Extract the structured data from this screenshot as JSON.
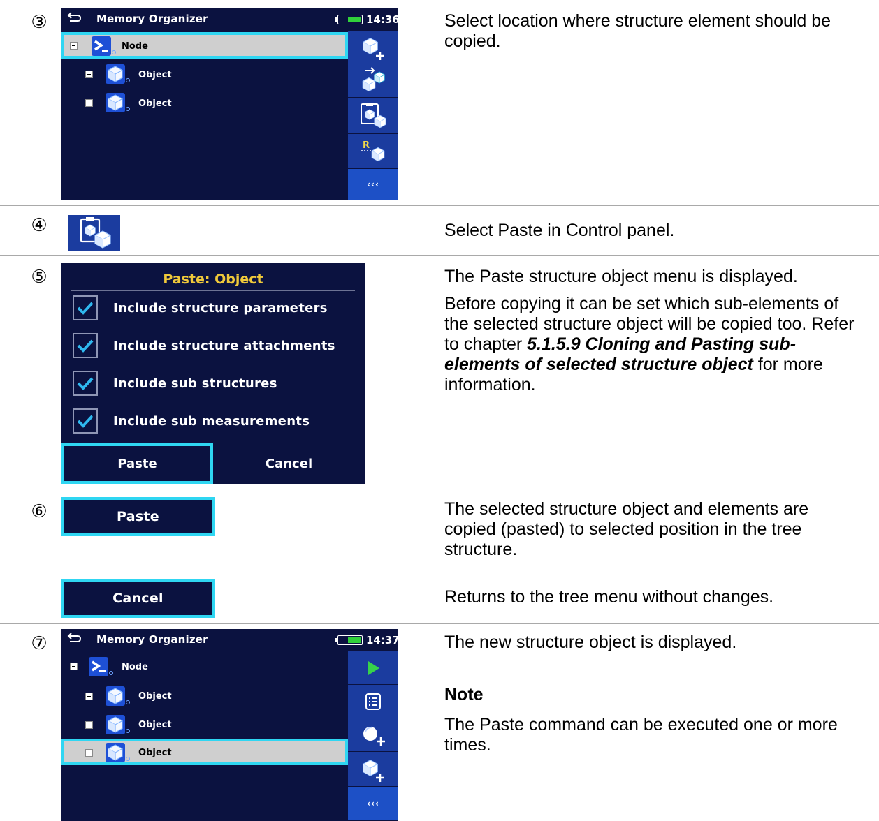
{
  "steps": [
    {
      "number": "③",
      "screen": {
        "title": "Memory Organizer",
        "time": "14:36",
        "battery_icon": "battery-icon",
        "tree": [
          {
            "label": "Node",
            "icon": "node-icon",
            "expander": "minus",
            "selected": true
          },
          {
            "label": "Object",
            "icon": "object-icon",
            "expander": "plus",
            "selected": false
          },
          {
            "label": "Object",
            "icon": "object-icon",
            "expander": "plus",
            "selected": false
          }
        ],
        "panel": [
          "add-structure-icon",
          "copy-structure-icon",
          "paste-structure-icon",
          "recall-structure-icon"
        ],
        "more_label": "‹‹‹"
      },
      "text": "Select location where structure element should be copied."
    },
    {
      "number": "④",
      "icon": "paste-structure-icon",
      "text": "Select Paste in Control panel."
    },
    {
      "number": "⑤",
      "dialog": {
        "title": "Paste: Object",
        "options": [
          {
            "label": "Include structure parameters",
            "checked": true
          },
          {
            "label": "Include structure attachments",
            "checked": true
          },
          {
            "label": "Include sub structures",
            "checked": true
          },
          {
            "label": "Include sub measurements",
            "checked": true
          }
        ],
        "paste_label": "Paste",
        "cancel_label": "Cancel"
      },
      "text_1": "The Paste structure object menu is displayed.",
      "text_2a": "Before copying it can be set which sub-elements of the selected structure object will be copied too. Refer to chapter ",
      "text_2b": "5.1.5.9 Cloning and Pasting sub-elements of selected structure object",
      "text_2c": " for more information."
    },
    {
      "number": "⑥",
      "paste_label": "Paste",
      "cancel_label": "Cancel",
      "paste_text": "The selected structure object and elements are copied (pasted) to selected position in the tree structure.",
      "cancel_text": "Returns to the tree menu without changes."
    },
    {
      "number": "⑦",
      "screen": {
        "title": "Memory Organizer",
        "time": "14:37",
        "battery_icon": "battery-icon",
        "tree": [
          {
            "label": "Node",
            "icon": "node-icon",
            "expander": "minus",
            "selected": false
          },
          {
            "label": "Object",
            "icon": "object-icon",
            "expander": "plus",
            "selected": false
          },
          {
            "label": "Object",
            "icon": "object-icon",
            "expander": "plus",
            "selected": false
          },
          {
            "label": "Object",
            "icon": "object-icon",
            "expander": "plus",
            "selected": true
          }
        ],
        "panel": [
          "play-icon",
          "list-icon",
          "add-measurement-icon",
          "add-structure-icon"
        ],
        "more_label": "‹‹‹"
      },
      "text": "The new structure object is displayed.",
      "note_title": "Note",
      "note_text": "The Paste command can be executed one or more times."
    }
  ],
  "colors": {
    "screen_bg": "#0b1240",
    "panel_bg": "#1b3c9f",
    "highlight": "#2fd6f2",
    "dialog_title": "#f0c93a",
    "check": "#2fb8ef",
    "icon_blue": "#1e50d6"
  }
}
